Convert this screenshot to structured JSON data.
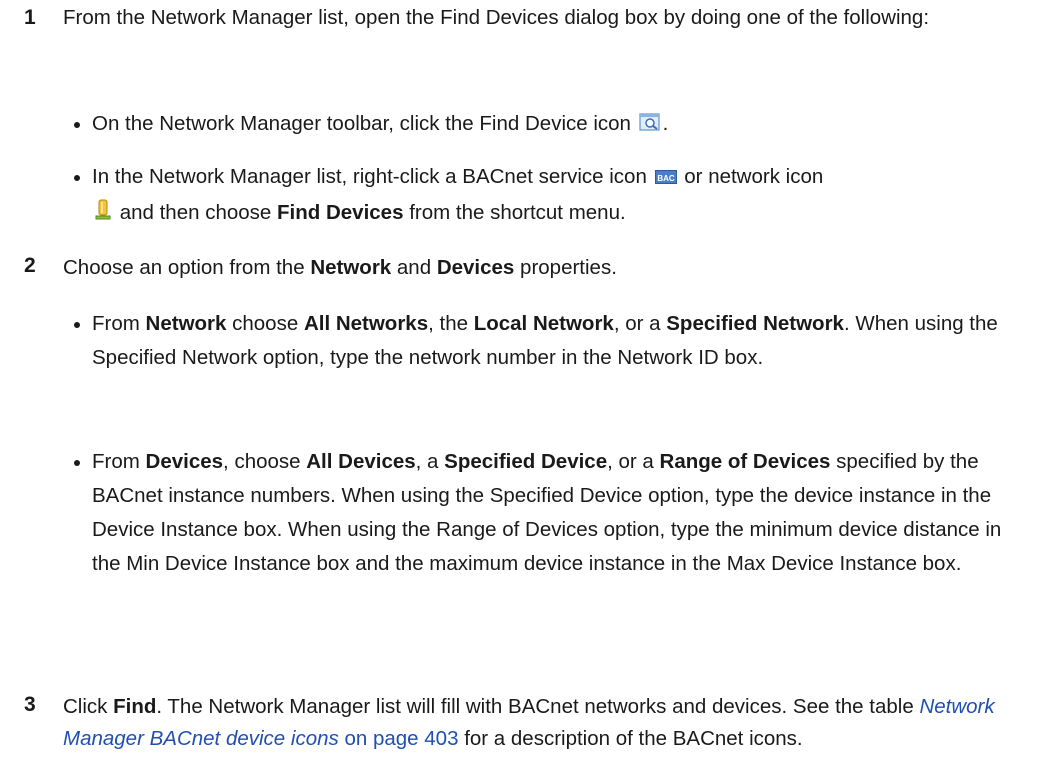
{
  "steps": [
    {
      "number": "1",
      "text": "From the Network Manager list, open the Find Devices dialog box by doing one of the following:",
      "bullets": [
        {
          "pre": "On the Network Manager toolbar, click the Find Device icon",
          "post": "."
        },
        {
          "pre": "In the Network Manager list, right-click a BACnet service icon",
          "mid": "or network icon",
          "and_then": "and then choose",
          "bold": "Find Devices",
          "post": "from the shortcut menu."
        }
      ]
    },
    {
      "number": "2",
      "text_pre": "Choose an option from the",
      "bold1": "Network",
      "text_mid": "and",
      "bold2": "Devices",
      "text_post": "properties.",
      "bullets": [
        {
          "from": "From",
          "network": "Network",
          "choose": "choose",
          "all": "All Networks",
          "the": ", the",
          "local": "Local Network",
          "ora": ", or a",
          "specified": "Specified Network",
          "rest": ". When using the Specified Network option, type the network number in the Network ID box."
        },
        {
          "from": "From",
          "devices": "Devices",
          "choose": ", choose",
          "all": "All Devices",
          "a": ", a",
          "specified": "Specified Device",
          "ora": ", or a",
          "range": "Range of Devices",
          "rest": "specified by the BACnet instance numbers. When using the Specified Device option, type the device instance in the Device Instance box. When using the Range of Devices option, type the minimum device distance in the Min Device Instance box and the maximum device instance in the Max Device Instance box."
        }
      ]
    },
    {
      "number": "3",
      "click": "Click",
      "find": "Find",
      "text1": ". The Network Manager list will fill with BACnet networks and devices. See the table",
      "link": "Network Manager BACnet device icons",
      "page": "on page 403",
      "text2": "for a description of the BACnet icons."
    }
  ],
  "icons": {
    "find_device": "find-device-icon",
    "bacnet_service": "bacnet-service-icon",
    "bacnet_service_label": "BAC",
    "network": "network-icon"
  }
}
